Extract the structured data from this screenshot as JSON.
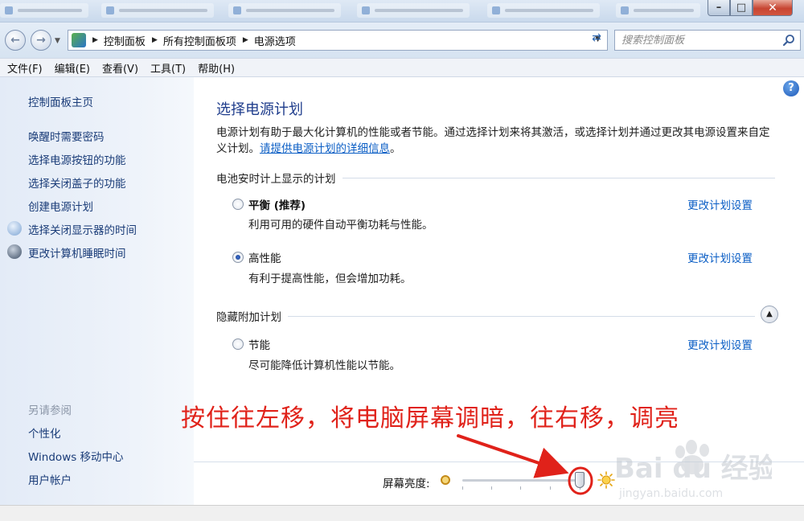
{
  "window": {
    "controls": {
      "minimize": "–",
      "maximize": "□",
      "close": "✕"
    }
  },
  "address": {
    "crumbs": [
      "控制面板",
      "所有控制面板项",
      "电源选项"
    ],
    "search_placeholder": "搜索控制面板"
  },
  "menu": [
    "文件(F)",
    "编辑(E)",
    "查看(V)",
    "工具(T)",
    "帮助(H)"
  ],
  "sidebar": {
    "home": "控制面板主页",
    "items": [
      {
        "label": "唤醒时需要密码",
        "icon": ""
      },
      {
        "label": "选择电源按钮的功能",
        "icon": ""
      },
      {
        "label": "选择关闭盖子的功能",
        "icon": ""
      },
      {
        "label": "创建电源计划",
        "icon": ""
      },
      {
        "label": "选择关闭显示器的时间",
        "icon": "monitor-icon"
      },
      {
        "label": "更改计算机睡眠时间",
        "icon": "moon-icon"
      }
    ],
    "see_also_title": "另请参阅",
    "see_also": [
      "个性化",
      "Windows 移动中心",
      "用户帐户"
    ]
  },
  "main": {
    "title": "选择电源计划",
    "intro": "电源计划有助于最大化计算机的性能或者节能。通过选择计划来将其激活，或选择计划并通过更改其电源设置来自定义计划。",
    "intro_link": "请提供电源计划的详细信息",
    "intro_end": "。",
    "group1_title": "电池安时计上显示的计划",
    "group2_title": "隐藏附加计划",
    "change_link": "更改计划设置",
    "plans": [
      {
        "name": "平衡 (推荐)",
        "desc": "利用可用的硬件自动平衡功耗与性能。",
        "selected": false
      },
      {
        "name": "高性能",
        "desc": "有利于提高性能，但会增加功耗。",
        "selected": true
      },
      {
        "name": "节能",
        "desc": "尽可能降低计算机性能以节能。",
        "selected": false
      }
    ]
  },
  "brightness": {
    "label": "屏幕亮度:",
    "level": 1.0
  },
  "annotation": {
    "text": "按住往左移，将电脑屏幕调暗，往右移，调亮",
    "color": "#e0221a"
  },
  "watermark": {
    "brand": "Bai du 经验",
    "url": "jingyan.baidu.com"
  },
  "colors": {
    "link": "#0b5ec5",
    "title": "#1f3d8c",
    "sidebar_link": "#1a3c78"
  }
}
